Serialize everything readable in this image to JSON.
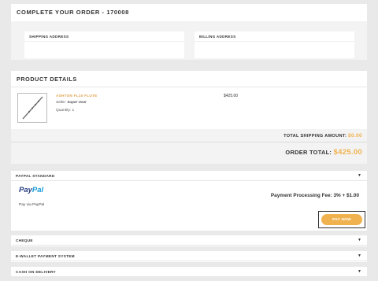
{
  "order": {
    "title": "COMPLETE YOUR ORDER - 170008",
    "shipping_label": "SHIPPING ADDRESS",
    "billing_label": "BILLING ADDRESS"
  },
  "product": {
    "section_title": "PRODUCT DETAILS",
    "name": "ASHTON FL10 FLUTE",
    "seller_prefix": "Seller: ",
    "seller": "Super User",
    "quantity": "Quantity: 1",
    "price": "$425.00",
    "shipping_label": "TOTAL SHIPPING AMOUNT:",
    "shipping_value": "$0.00",
    "total_label": "ORDER TOTAL:",
    "total_value": "$425.00"
  },
  "payment": {
    "paypal_title": "PAYPAL STANDARD",
    "paypal_logo_a": "Pay",
    "paypal_logo_b": "Pal",
    "pay_via": "Pay via PayPal",
    "fee": "Payment Processing Fee: 3% + $1.00",
    "pay_now": "PAY NOW",
    "options": [
      "CHEQUE",
      "E-WALLET PAYMENT SYSTEM",
      "CASH ON DELIVERY"
    ]
  },
  "icons": {
    "chevron": "chevron-down-icon",
    "product_image": "flute-image"
  },
  "colors": {
    "accent": "#f0b24e",
    "product_name": "#e0a24d",
    "paypal_dark": "#253b80",
    "paypal_light": "#179bd7"
  }
}
